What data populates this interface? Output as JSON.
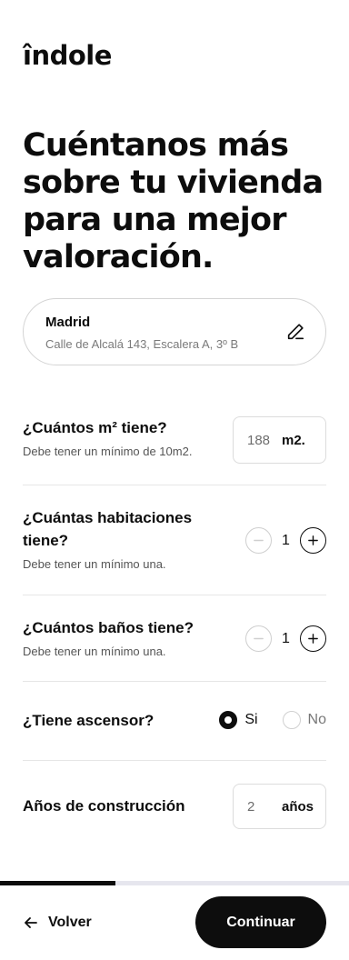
{
  "brand": {
    "name": "îndole"
  },
  "header": {
    "title": "Cuéntanos más sobre tu vivienda para una mejor valoración."
  },
  "address": {
    "city": "Madrid",
    "street": "Calle de Alcalá 143, Escalera A, 3º B",
    "edit_icon": "pencil-icon"
  },
  "questions": {
    "area": {
      "label": "¿Cuántos m² tiene?",
      "help": "Debe tener un mínimo de 10m2.",
      "value": "188",
      "unit": "m2."
    },
    "rooms": {
      "label": "¿Cuántas habitaciones tiene?",
      "help": "Debe tener un mínimo una.",
      "value": "1"
    },
    "baths": {
      "label": "¿Cuántos baños tiene?",
      "help": "Debe tener un mínimo una.",
      "value": "1"
    },
    "elevator": {
      "label": "¿Tiene ascensor?",
      "options": [
        "Si",
        "No"
      ],
      "selected": "Si"
    },
    "age": {
      "label": "Años de construcción",
      "value": "2",
      "unit": "años"
    }
  },
  "progress": {
    "fraction": 0.33
  },
  "footer": {
    "back_label": "Volver",
    "continue_label": "Continuar"
  },
  "colors": {
    "primary": "#0d0d0d",
    "border": "#d4d4d4",
    "muted": "#7a7a7a"
  }
}
